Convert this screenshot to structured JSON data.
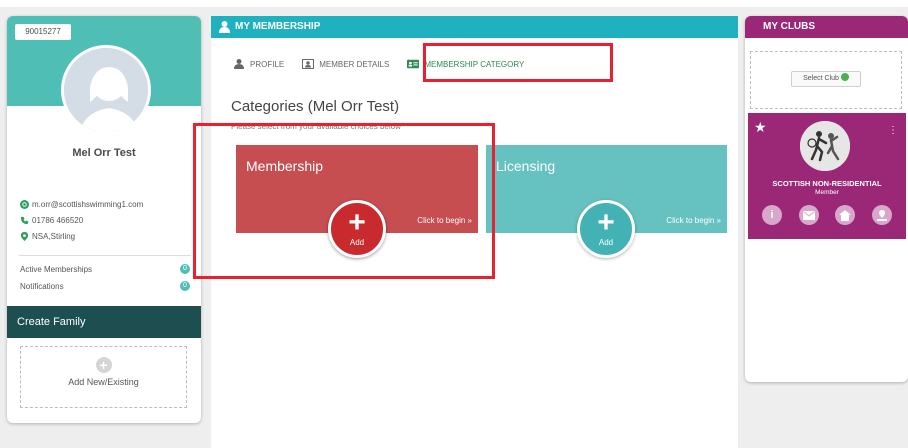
{
  "profile": {
    "member_id": "90015277",
    "name": "Mel Orr Test",
    "email": "m.orr@scottishswimming1.com",
    "phone": "01786 466520",
    "location": "NSA,Stirling",
    "stats": [
      {
        "label": "Active Memberships",
        "count": "0"
      },
      {
        "label": "Notifications",
        "count": "0"
      }
    ],
    "create_family_label": "Create Family",
    "add_new_label": "Add New/Existing"
  },
  "membership": {
    "header": "MY MEMBERSHIP",
    "tabs": [
      {
        "label": "PROFILE",
        "icon": "person-icon"
      },
      {
        "label": "MEMBER DETAILS",
        "icon": "id-card-icon"
      },
      {
        "label": "MEMBERSHIP CATEGORY",
        "icon": "category-card-icon"
      }
    ],
    "title": "Categories (Mel Orr Test)",
    "subtitle": "Please select from your available choices below",
    "cards": [
      {
        "title": "Membership",
        "begin": "Click to begin »",
        "add": "Add"
      },
      {
        "title": "Licensing",
        "begin": "Click to begin »",
        "add": "Add"
      }
    ]
  },
  "clubs": {
    "header": "MY CLUBS",
    "select_label": "Select Club",
    "club_name": "SCOTTISH NON-RESIDENTIAL",
    "club_role": "Member",
    "icons": [
      "info-icon",
      "mail-icon",
      "home-icon",
      "location-icon"
    ]
  },
  "colors": {
    "teal": "#4fbfb6",
    "header_blue": "#1fb1c0",
    "membership_red": "#c64d50",
    "licensing_teal": "#66c1c1",
    "club_purple": "#9b2777",
    "family_dark": "#1e4f50",
    "highlight_red": "#e8202f"
  }
}
